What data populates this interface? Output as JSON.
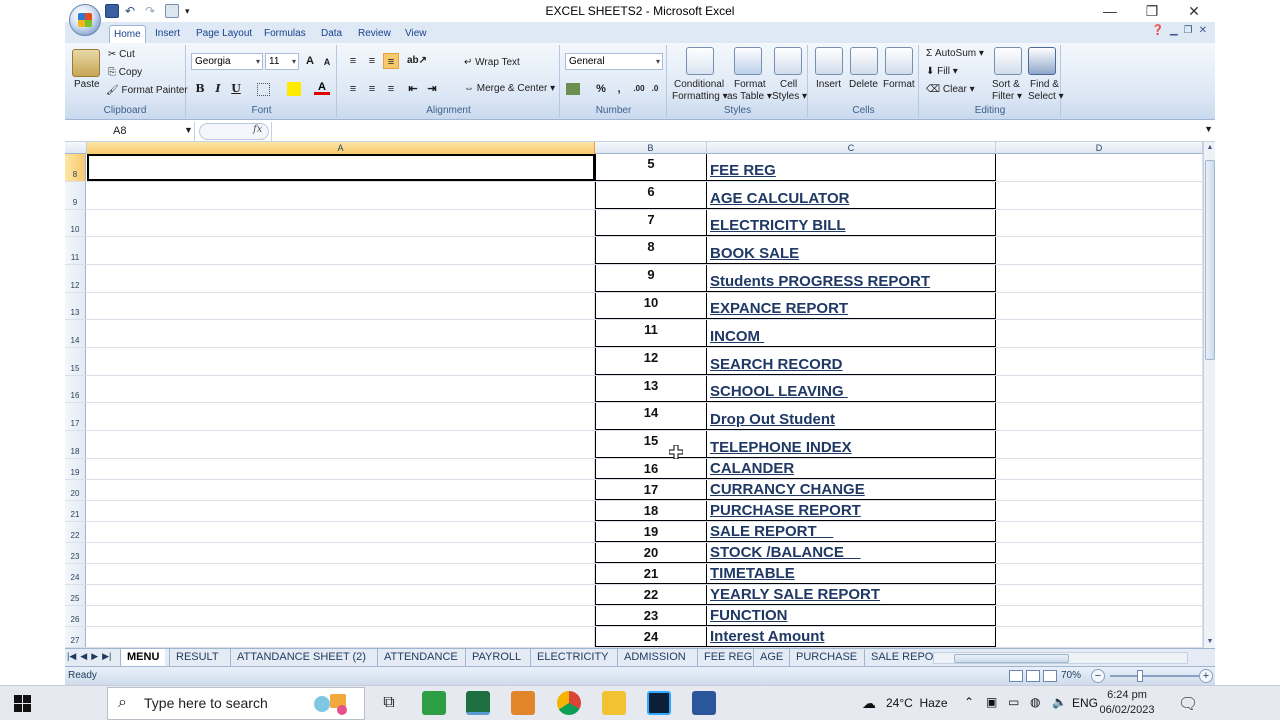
{
  "window": {
    "title": "EXCEL SHEETS2 - Microsoft Excel",
    "minimize": "—",
    "restore": "❐",
    "close": "✕"
  },
  "ribbon_tabs": [
    "Home",
    "Insert",
    "Page Layout",
    "Formulas",
    "Data",
    "Review",
    "View"
  ],
  "clipboard": {
    "paste": "Paste",
    "cut": "Cut",
    "copy": "Copy",
    "format_painter": "Format Painter",
    "label": "Clipboard"
  },
  "font": {
    "name": "Georgia",
    "size": "11",
    "label": "Font"
  },
  "alignment": {
    "wrap": "Wrap Text",
    "merge": "Merge & Center",
    "label": "Alignment"
  },
  "number": {
    "format": "General",
    "label": "Number"
  },
  "styles": {
    "conditional": "Conditional",
    "conditional2": "Formatting",
    "format_table": "Format",
    "format_table2": "as Table",
    "cell_styles": "Cell",
    "cell_styles2": "Styles",
    "label": "Styles"
  },
  "cells": {
    "insert": "Insert",
    "delete": "Delete",
    "format": "Format",
    "label": "Cells"
  },
  "editing": {
    "autosum": "AutoSum",
    "fill": "Fill",
    "clear": "Clear",
    "sort": "Sort &",
    "sort2": "Filter",
    "find": "Find &",
    "find2": "Select",
    "label": "Editing"
  },
  "namebox": "A8",
  "fx": "fx",
  "columns": [
    "A",
    "B",
    "C",
    "D"
  ],
  "rows": [
    {
      "n": "8",
      "b": "5",
      "c": "FEE REG"
    },
    {
      "n": "9",
      "b": "6",
      "c": "AGE CALCULATOR"
    },
    {
      "n": "10",
      "b": "7",
      "c": "ELECTRICITY BILL"
    },
    {
      "n": "11",
      "b": "8",
      "c": "BOOK SALE"
    },
    {
      "n": "12",
      "b": "9",
      "c": "Students PROGRESS REPORT"
    },
    {
      "n": "13",
      "b": "10",
      "c": "EXPANCE REPORT"
    },
    {
      "n": "14",
      "b": "11",
      "c": "INCOM "
    },
    {
      "n": "15",
      "b": "12",
      "c": "SEARCH RECORD"
    },
    {
      "n": "16",
      "b": "13",
      "c": "SCHOOL LEAVING "
    },
    {
      "n": "17",
      "b": "14",
      "c": "Drop Out Student"
    },
    {
      "n": "18",
      "b": "15",
      "c": "TELEPHONE INDEX"
    },
    {
      "n": "19",
      "b": "16",
      "c": "CALANDER"
    },
    {
      "n": "20",
      "b": "17",
      "c": "CURRANCY CHANGE"
    },
    {
      "n": "21",
      "b": "18",
      "c": "PURCHASE REPORT"
    },
    {
      "n": "22",
      "b": "19",
      "c": "SALE REPORT    "
    },
    {
      "n": "23",
      "b": "20",
      "c": "STOCK /BALANCE    "
    },
    {
      "n": "24",
      "b": "21",
      "c": "TIMETABLE"
    },
    {
      "n": "25",
      "b": "22",
      "c": "YEARLY SALE REPORT"
    },
    {
      "n": "26",
      "b": "23",
      "c": "FUNCTION"
    },
    {
      "n": "27",
      "b": "24",
      "c": "Interest Amount"
    }
  ],
  "sheet_tabs": [
    "MENU",
    "RESULT",
    "ATTANDANCE SHEET (2)",
    "ATTENDANCE",
    "PAYROLL",
    "ELECTRICITY",
    "ADMISSION",
    "FEE REG",
    "AGE",
    "PURCHASE",
    "SALE REPO"
  ],
  "status": {
    "ready": "Ready",
    "zoom": "70%"
  },
  "taskbar": {
    "search_placeholder": "Type here to search",
    "weather": "24°C  Haze",
    "lang": "ENG",
    "time": "6:24 pm",
    "date": "06/02/2023"
  }
}
